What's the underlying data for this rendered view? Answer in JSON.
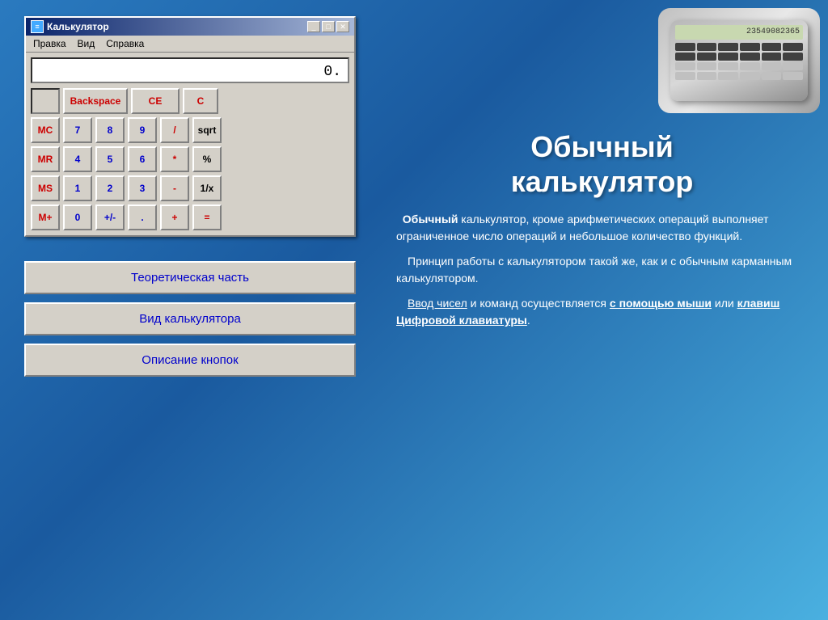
{
  "window": {
    "title": "Калькулятор",
    "menu": [
      "Правка",
      "Вид",
      "Справка"
    ]
  },
  "display": {
    "value": "0."
  },
  "buttons": {
    "row0": [
      {
        "label": "",
        "type": "check"
      },
      {
        "label": "Backspace",
        "type": "backspace"
      },
      {
        "label": "CE",
        "type": "ce"
      },
      {
        "label": "C",
        "type": "c"
      }
    ],
    "row1": [
      {
        "label": "MC",
        "type": "mem"
      },
      {
        "label": "7",
        "type": "digit"
      },
      {
        "label": "8",
        "type": "digit"
      },
      {
        "label": "9",
        "type": "digit"
      },
      {
        "label": "/",
        "type": "op"
      },
      {
        "label": "sqrt",
        "type": "fn"
      }
    ],
    "row2": [
      {
        "label": "MR",
        "type": "mem"
      },
      {
        "label": "4",
        "type": "digit"
      },
      {
        "label": "5",
        "type": "digit"
      },
      {
        "label": "6",
        "type": "digit"
      },
      {
        "label": "*",
        "type": "op"
      },
      {
        "label": "%",
        "type": "fn"
      }
    ],
    "row3": [
      {
        "label": "MS",
        "type": "mem"
      },
      {
        "label": "1",
        "type": "digit"
      },
      {
        "label": "2",
        "type": "digit"
      },
      {
        "label": "3",
        "type": "digit"
      },
      {
        "label": "-",
        "type": "op"
      },
      {
        "label": "1/x",
        "type": "fn"
      }
    ],
    "row4": [
      {
        "label": "M+",
        "type": "mem"
      },
      {
        "label": "0",
        "type": "digit"
      },
      {
        "label": "+/-",
        "type": "digit"
      },
      {
        "label": ".",
        "type": "digit"
      },
      {
        "label": "+",
        "type": "op"
      },
      {
        "label": "=",
        "type": "eq"
      }
    ]
  },
  "nav": {
    "btn1": "Теоретическая часть",
    "btn2": "Вид калькулятора",
    "btn3": "Описание кнопок"
  },
  "right": {
    "title_line1": "Обычный",
    "title_line2": "калькулятор",
    "calc_display": "23549082365",
    "para1_bold": "Обычный",
    "para1_rest": " калькулятор, кроме арифметических операций выполняет ограниченное число операций и небольшое количество функций.",
    "para2": "Принцип работы с калькулятором такой же, как и с обычным карманным калькулятором.",
    "para3_underline1": "Ввод чисел",
    "para3_mid": " и команд осуществляется ",
    "para3_underline2": "с помощью мыши",
    "para3_mid2": " или ",
    "para3_underline3": "клавиш Цифровой клавиатуры",
    "para3_end": "."
  }
}
